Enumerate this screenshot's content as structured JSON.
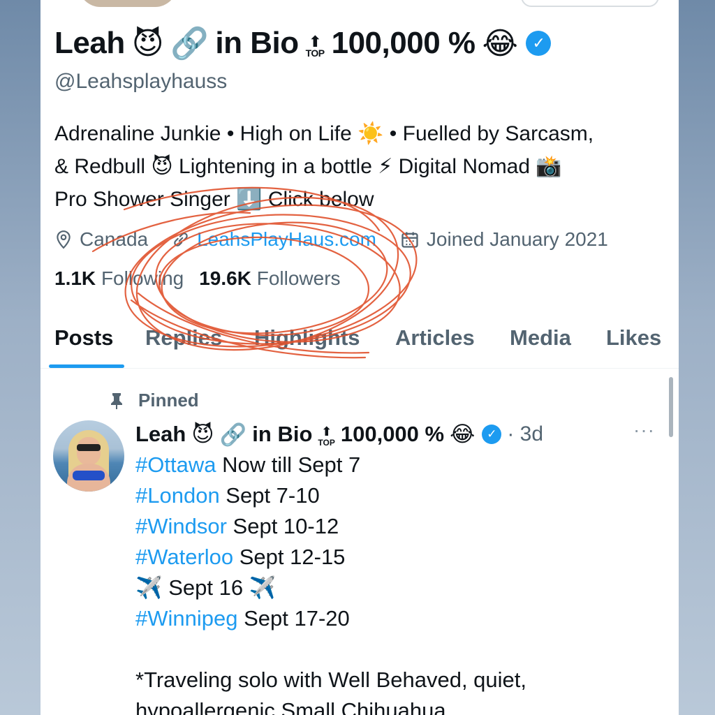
{
  "profile": {
    "name_parts": [
      "Leah",
      "😈",
      "🔗",
      "in Bio",
      "TOP",
      "100,000 %",
      "😂"
    ],
    "handle": "@Leahsplayhauss",
    "bio_lines": [
      "Adrenaline Junkie • High on Life ☀️ • Fuelled by Sarcasm,",
      "& Redbull 😈 Lightening in a bottle ⚡ Digital Nomad 📸",
      "Pro Shower Singer ⬇️ Click below"
    ],
    "location": "Canada",
    "website": "LeahsPlayHaus.com",
    "joined": "Joined January 2021",
    "following_count": "1.1K",
    "following_label": "Following",
    "followers_count": "19.6K",
    "followers_label": "Followers",
    "verified_check": "✓"
  },
  "tabs": [
    "Posts",
    "Replies",
    "Highlights",
    "Articles",
    "Media",
    "Likes"
  ],
  "post": {
    "pinned_label": "Pinned",
    "author_parts": [
      "Leah",
      "😈",
      "🔗",
      "in Bio",
      "TOP",
      "100,000 %",
      "😂"
    ],
    "time": "3d",
    "more": "···",
    "lines": [
      {
        "tag": "#Ottawa",
        "text": " Now till Sept 7"
      },
      {
        "tag": "#London",
        "text": " Sept 7-10"
      },
      {
        "tag": "#Windsor",
        "text": " Sept 10-12"
      },
      {
        "tag": "#Waterloo",
        "text": " Sept 12-15"
      },
      {
        "tag": "",
        "text": "✈️ Sept 16 ✈️"
      },
      {
        "tag": "#Winnipeg",
        "text": " Sept 17-20"
      }
    ],
    "note_lines": [
      "*Traveling solo with Well Behaved, quiet,",
      "hypoallergenic Small Chihuahua"
    ]
  },
  "colors": {
    "accent": "#1d9bf0",
    "secondary_text": "#536471",
    "scribble": "#e0522d"
  },
  "icons": {
    "location": "location-pin-icon",
    "link": "link-icon",
    "calendar": "calendar-icon",
    "pin": "pin-icon",
    "more": "more-icon"
  }
}
